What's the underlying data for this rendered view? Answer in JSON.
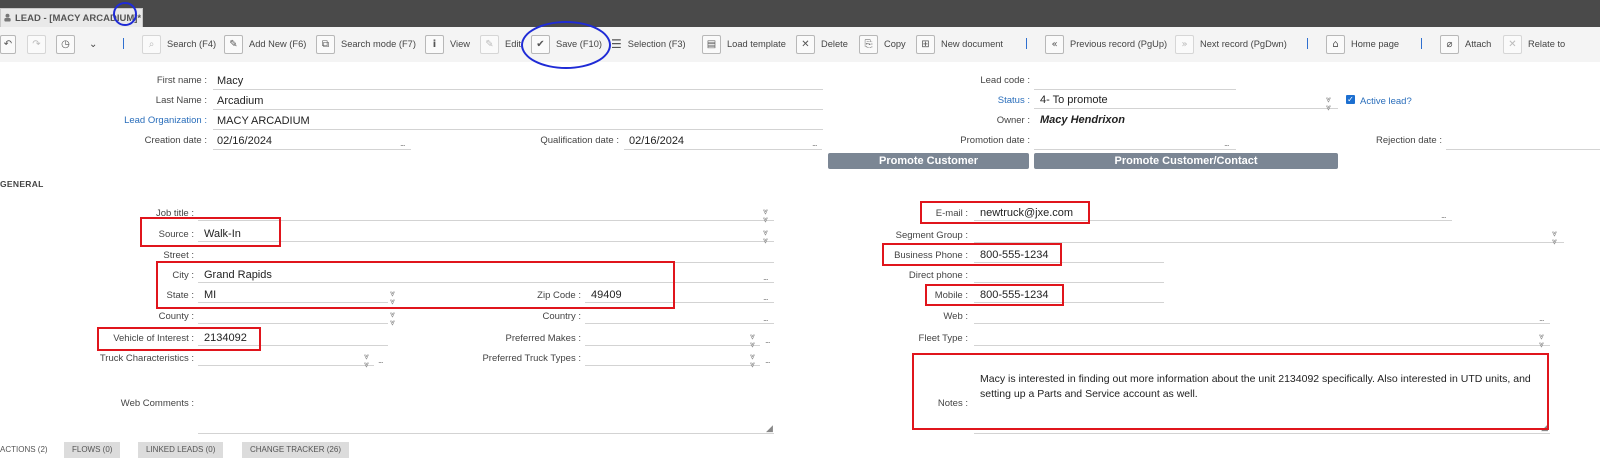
{
  "window": {
    "tab_title": "LEAD - [MACY ARCADIUM]*"
  },
  "toolbar": {
    "search": "Search (F4)",
    "add_new": "Add New (F6)",
    "search_mode": "Search mode (F7)",
    "view": "View",
    "edit": "Edit",
    "save": "Save (F10)",
    "selection": "Selection (F3)",
    "load_template": "Load template",
    "delete": "Delete",
    "copy": "Copy",
    "new_document": "New document",
    "previous_record": "Previous record (PgUp)",
    "next_record": "Next record (PgDwn)",
    "home_page": "Home page",
    "attach": "Attach",
    "relate_to": "Relate to"
  },
  "header": {
    "first_name": {
      "label": "First name :",
      "value": "Macy"
    },
    "last_name": {
      "label": "Last Name :",
      "value": "Arcadium"
    },
    "lead_organization": {
      "label": "Lead Organization :",
      "value": "MACY ARCADIUM"
    },
    "creation_date": {
      "label": "Creation date :",
      "value": "02/16/2024"
    },
    "qualification_date": {
      "label": "Qualification date :",
      "value": "02/16/2024"
    },
    "lead_code": {
      "label": "Lead code :",
      "value": ""
    },
    "status": {
      "label": "Status :",
      "value": "4- To promote"
    },
    "active_lead": {
      "label": "Active lead?",
      "checked": true
    },
    "owner": {
      "label": "Owner :",
      "value": "Macy Hendrixon"
    },
    "promotion_date": {
      "label": "Promotion date :",
      "value": ""
    },
    "rejection_date": {
      "label": "Rejection date :",
      "value": ""
    },
    "promote_customer": "Promote Customer",
    "promote_customer_contact": "Promote Customer/Contact"
  },
  "section_general": "GENERAL",
  "general": {
    "job_title": {
      "label": "Job title :",
      "value": ""
    },
    "source": {
      "label": "Source :",
      "value": "Walk-In"
    },
    "street": {
      "label": "Street :",
      "value": ""
    },
    "city": {
      "label": "City :",
      "value": "Grand Rapids"
    },
    "state": {
      "label": "State :",
      "value": "MI"
    },
    "zip_code": {
      "label": "Zip Code :",
      "value": "49409"
    },
    "county": {
      "label": "County :",
      "value": ""
    },
    "country": {
      "label": "Country :",
      "value": ""
    },
    "vehicle_of_interest": {
      "label": "Vehicle of Interest :",
      "value": "2134092"
    },
    "preferred_makes": {
      "label": "Preferred Makes :",
      "value": ""
    },
    "truck_characteristics": {
      "label": "Truck Characteristics :",
      "value": ""
    },
    "preferred_truck_types": {
      "label": "Preferred Truck Types :",
      "value": ""
    },
    "web_comments": {
      "label": "Web Comments :",
      "value": ""
    },
    "email": {
      "label": "E-mail :",
      "value": "newtruck@jxe.com"
    },
    "segment_group": {
      "label": "Segment Group :",
      "value": ""
    },
    "business_phone": {
      "label": "Business Phone :",
      "value": "800-555-1234"
    },
    "direct_phone": {
      "label": "Direct phone :",
      "value": ""
    },
    "mobile": {
      "label": "Mobile :",
      "value": "800-555-1234"
    },
    "web": {
      "label": "Web :",
      "value": ""
    },
    "fleet_type": {
      "label": "Fleet Type :",
      "value": ""
    },
    "notes": {
      "label": "Notes :",
      "value": "Macy is interested in finding out more information about the unit 2134092 specifically. Also interested in UTD units, and setting up a Parts and Service account as well."
    }
  },
  "bottom_tabs": [
    "ACTIONS (2)",
    "FLOWS (0)",
    "LINKED LEADS (0)",
    "CHANGE TRACKER (26)"
  ],
  "colors": {
    "annotation_red": "#e0151c",
    "annotation_blue": "#1f2bd6",
    "link_blue": "#2a6ebb",
    "promote_button": "#7b8694"
  }
}
